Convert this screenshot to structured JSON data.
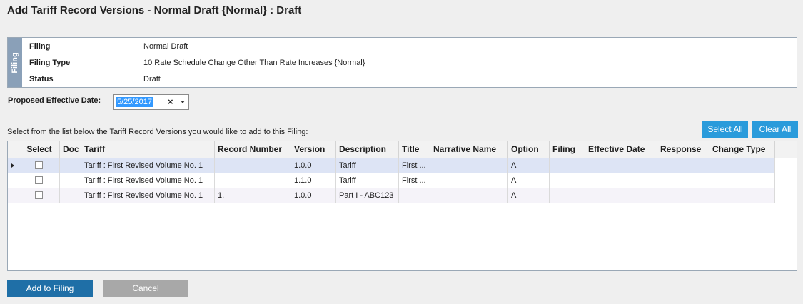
{
  "page": {
    "title": "Add Tariff Record Versions - Normal Draft {Normal} : Draft"
  },
  "filing": {
    "tab_label": "Filing",
    "rows": [
      {
        "key": "Filing",
        "value": "Normal Draft"
      },
      {
        "key": "Filing Type",
        "value": "10 Rate Schedule Change Other Than Rate Increases {Normal}"
      },
      {
        "key": "Status",
        "value": "Draft"
      }
    ]
  },
  "date": {
    "label": "Proposed Effective Date:",
    "value": "5/25/2017",
    "clear_icon": "×"
  },
  "instructions": "Select from the list below the Tariff Record Versions you would like to add to this Filing:",
  "grid_actions": {
    "select_all": "Select All",
    "clear_all": "Clear All"
  },
  "grid": {
    "headers": [
      "Select",
      "Doc",
      "Tariff",
      "Record Number",
      "Version",
      "Description",
      "Title",
      "Narrative Name",
      "Option",
      "Filing",
      "Effective Date",
      "Response",
      "Change Type"
    ],
    "rows": [
      {
        "tariff": "Tariff : First Revised Volume No. 1",
        "record_number": "",
        "version": "1.0.0",
        "description": "Tariff",
        "title": "First ...",
        "narrative": "",
        "option": "A",
        "filing": "",
        "effective_date": "",
        "response": "",
        "change_type": ""
      },
      {
        "tariff": "Tariff : First Revised Volume No. 1",
        "record_number": "",
        "version": "1.1.0",
        "description": "Tariff",
        "title": "First ...",
        "narrative": "",
        "option": "A",
        "filing": "",
        "effective_date": "",
        "response": "",
        "change_type": ""
      },
      {
        "tariff": "Tariff : First Revised Volume No. 1",
        "record_number": "1.",
        "version": "1.0.0",
        "description": "Part I - ABC123",
        "title": "",
        "narrative": "",
        "option": "A",
        "filing": "",
        "effective_date": "",
        "response": "",
        "change_type": ""
      }
    ]
  },
  "footer": {
    "add_label": "Add to Filing",
    "cancel_label": "Cancel"
  }
}
